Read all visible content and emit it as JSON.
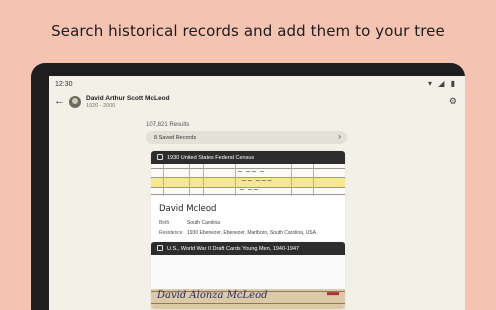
{
  "headline": "Search historical records and add them to your tree",
  "status": {
    "time": "12:30",
    "icons": "▾ ◢ ▮"
  },
  "appbar": {
    "back_glyph": "←",
    "person_name": "David Arthur Scott McLeod",
    "person_dates": "1920 - 2000",
    "filter_glyph": "⚙"
  },
  "results": {
    "count": "107,821 Results"
  },
  "saved": {
    "label": "8 Saved Records",
    "chevron": "›"
  },
  "records": [
    {
      "collection": "1930 United States Federal Census",
      "name": "David Mcleod",
      "fields": [
        {
          "key": "Birth",
          "value": "South Carolina"
        },
        {
          "key": "Residence",
          "value": "1930 Ebenezer, Ebenezer, Marlboro, South Carolina, USA"
        }
      ]
    },
    {
      "collection": "U.S., World War II Draft Cards Young Men, 1940-1947",
      "handwriting": "David Alonza McLeod"
    }
  ],
  "colors": {
    "background": "#f4c3b2",
    "highlight": "#f6e98a",
    "card_header": "#2d2d2d"
  }
}
